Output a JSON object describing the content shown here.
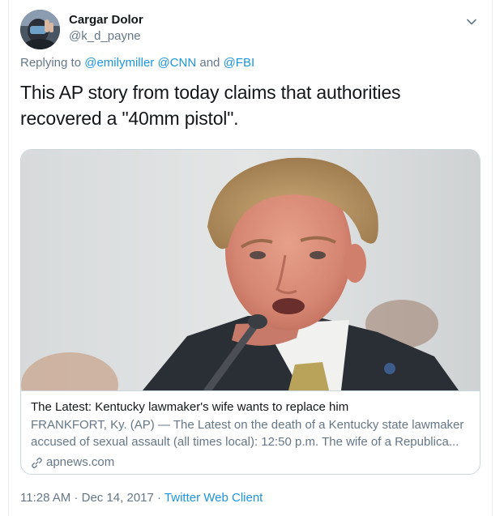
{
  "tweet": {
    "display_name": "Cargar Dolor",
    "handle": "@k_d_payne",
    "reply_prefix": "Replying to",
    "reply_mentions": [
      "@emilymiller",
      "@CNN",
      "@FBI"
    ],
    "reply_and": "and",
    "text": "This AP story from today claims that authorities recovered a \"40mm pistol\".",
    "time": "11:28 AM",
    "date": "Dec 14, 2017",
    "separator": "·",
    "client": "Twitter Web Client"
  },
  "card": {
    "title": "The Latest: Kentucky lawmaker's wife wants to replace him",
    "description": "FRANKFORT, Ky. (AP) — The Latest on the death of a Kentucky state lawmaker accused of sexual assault (all times local): 12:50 p.m. The wife of a Republica...",
    "domain": "apnews.com"
  },
  "icons": {
    "caret": "chevron-down-icon",
    "link": "link-icon"
  },
  "colors": {
    "link_blue": "#1b95e0",
    "secondary_text": "#657786",
    "border": "#ccd6dd"
  }
}
